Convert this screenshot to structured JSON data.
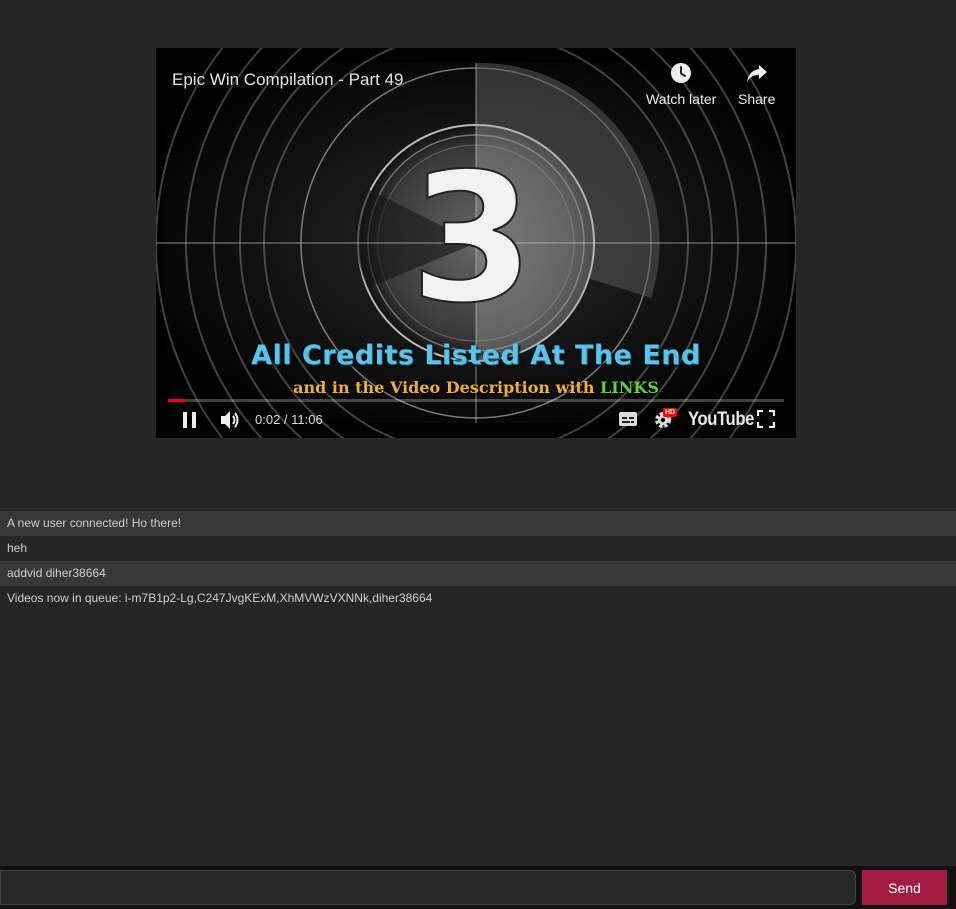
{
  "player": {
    "title": "Epic Win Compilation - Part 49",
    "watch_later_label": "Watch later",
    "share_label": "Share",
    "countdown_number": "3",
    "overlay_headline": "All Credits Listed At The End",
    "overlay_sub_prefix": "and in the Video Description with ",
    "overlay_sub_links": "LINKS",
    "time_display": "0:02 / 11:06",
    "progress_fraction": 0.003,
    "quality_badge": "HD",
    "logo_text": "YouTube",
    "progress_color": "#ff0000",
    "icons": [
      "clock-icon",
      "share-arrow-icon",
      "pause-icon",
      "volume-icon",
      "subtitles-icon",
      "settings-gear-icon",
      "fullscreen-icon"
    ]
  },
  "chat": {
    "messages": [
      "A new user connected! Ho there!",
      "heh",
      "addvid diher38664",
      "Videos now in queue: i-m7B1p2-Lg,C247JvgKExM,XhMVWzVXNNk,diher38664"
    ]
  },
  "composer": {
    "input_value": "",
    "input_placeholder": "",
    "send_label": "Send",
    "send_color": "#a31b43"
  }
}
